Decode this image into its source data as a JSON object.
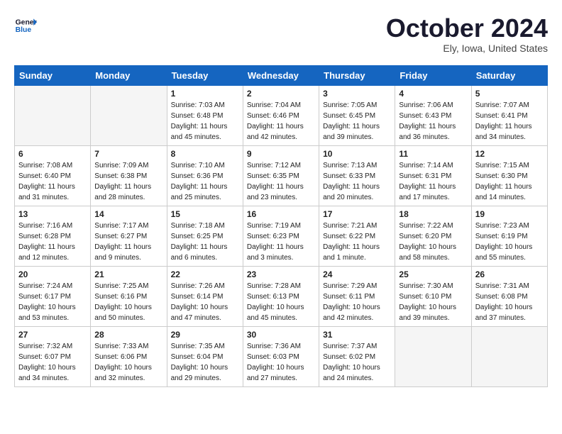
{
  "header": {
    "logo_line1": "General",
    "logo_line2": "Blue",
    "title": "October 2024",
    "subtitle": "Ely, Iowa, United States"
  },
  "weekdays": [
    "Sunday",
    "Monday",
    "Tuesday",
    "Wednesday",
    "Thursday",
    "Friday",
    "Saturday"
  ],
  "weeks": [
    [
      {
        "day": "",
        "info": ""
      },
      {
        "day": "",
        "info": ""
      },
      {
        "day": "1",
        "info": "Sunrise: 7:03 AM\nSunset: 6:48 PM\nDaylight: 11 hours\nand 45 minutes."
      },
      {
        "day": "2",
        "info": "Sunrise: 7:04 AM\nSunset: 6:46 PM\nDaylight: 11 hours\nand 42 minutes."
      },
      {
        "day": "3",
        "info": "Sunrise: 7:05 AM\nSunset: 6:45 PM\nDaylight: 11 hours\nand 39 minutes."
      },
      {
        "day": "4",
        "info": "Sunrise: 7:06 AM\nSunset: 6:43 PM\nDaylight: 11 hours\nand 36 minutes."
      },
      {
        "day": "5",
        "info": "Sunrise: 7:07 AM\nSunset: 6:41 PM\nDaylight: 11 hours\nand 34 minutes."
      }
    ],
    [
      {
        "day": "6",
        "info": "Sunrise: 7:08 AM\nSunset: 6:40 PM\nDaylight: 11 hours\nand 31 minutes."
      },
      {
        "day": "7",
        "info": "Sunrise: 7:09 AM\nSunset: 6:38 PM\nDaylight: 11 hours\nand 28 minutes."
      },
      {
        "day": "8",
        "info": "Sunrise: 7:10 AM\nSunset: 6:36 PM\nDaylight: 11 hours\nand 25 minutes."
      },
      {
        "day": "9",
        "info": "Sunrise: 7:12 AM\nSunset: 6:35 PM\nDaylight: 11 hours\nand 23 minutes."
      },
      {
        "day": "10",
        "info": "Sunrise: 7:13 AM\nSunset: 6:33 PM\nDaylight: 11 hours\nand 20 minutes."
      },
      {
        "day": "11",
        "info": "Sunrise: 7:14 AM\nSunset: 6:31 PM\nDaylight: 11 hours\nand 17 minutes."
      },
      {
        "day": "12",
        "info": "Sunrise: 7:15 AM\nSunset: 6:30 PM\nDaylight: 11 hours\nand 14 minutes."
      }
    ],
    [
      {
        "day": "13",
        "info": "Sunrise: 7:16 AM\nSunset: 6:28 PM\nDaylight: 11 hours\nand 12 minutes."
      },
      {
        "day": "14",
        "info": "Sunrise: 7:17 AM\nSunset: 6:27 PM\nDaylight: 11 hours\nand 9 minutes."
      },
      {
        "day": "15",
        "info": "Sunrise: 7:18 AM\nSunset: 6:25 PM\nDaylight: 11 hours\nand 6 minutes."
      },
      {
        "day": "16",
        "info": "Sunrise: 7:19 AM\nSunset: 6:23 PM\nDaylight: 11 hours\nand 3 minutes."
      },
      {
        "day": "17",
        "info": "Sunrise: 7:21 AM\nSunset: 6:22 PM\nDaylight: 11 hours\nand 1 minute."
      },
      {
        "day": "18",
        "info": "Sunrise: 7:22 AM\nSunset: 6:20 PM\nDaylight: 10 hours\nand 58 minutes."
      },
      {
        "day": "19",
        "info": "Sunrise: 7:23 AM\nSunset: 6:19 PM\nDaylight: 10 hours\nand 55 minutes."
      }
    ],
    [
      {
        "day": "20",
        "info": "Sunrise: 7:24 AM\nSunset: 6:17 PM\nDaylight: 10 hours\nand 53 minutes."
      },
      {
        "day": "21",
        "info": "Sunrise: 7:25 AM\nSunset: 6:16 PM\nDaylight: 10 hours\nand 50 minutes."
      },
      {
        "day": "22",
        "info": "Sunrise: 7:26 AM\nSunset: 6:14 PM\nDaylight: 10 hours\nand 47 minutes."
      },
      {
        "day": "23",
        "info": "Sunrise: 7:28 AM\nSunset: 6:13 PM\nDaylight: 10 hours\nand 45 minutes."
      },
      {
        "day": "24",
        "info": "Sunrise: 7:29 AM\nSunset: 6:11 PM\nDaylight: 10 hours\nand 42 minutes."
      },
      {
        "day": "25",
        "info": "Sunrise: 7:30 AM\nSunset: 6:10 PM\nDaylight: 10 hours\nand 39 minutes."
      },
      {
        "day": "26",
        "info": "Sunrise: 7:31 AM\nSunset: 6:08 PM\nDaylight: 10 hours\nand 37 minutes."
      }
    ],
    [
      {
        "day": "27",
        "info": "Sunrise: 7:32 AM\nSunset: 6:07 PM\nDaylight: 10 hours\nand 34 minutes."
      },
      {
        "day": "28",
        "info": "Sunrise: 7:33 AM\nSunset: 6:06 PM\nDaylight: 10 hours\nand 32 minutes."
      },
      {
        "day": "29",
        "info": "Sunrise: 7:35 AM\nSunset: 6:04 PM\nDaylight: 10 hours\nand 29 minutes."
      },
      {
        "day": "30",
        "info": "Sunrise: 7:36 AM\nSunset: 6:03 PM\nDaylight: 10 hours\nand 27 minutes."
      },
      {
        "day": "31",
        "info": "Sunrise: 7:37 AM\nSunset: 6:02 PM\nDaylight: 10 hours\nand 24 minutes."
      },
      {
        "day": "",
        "info": ""
      },
      {
        "day": "",
        "info": ""
      }
    ]
  ]
}
